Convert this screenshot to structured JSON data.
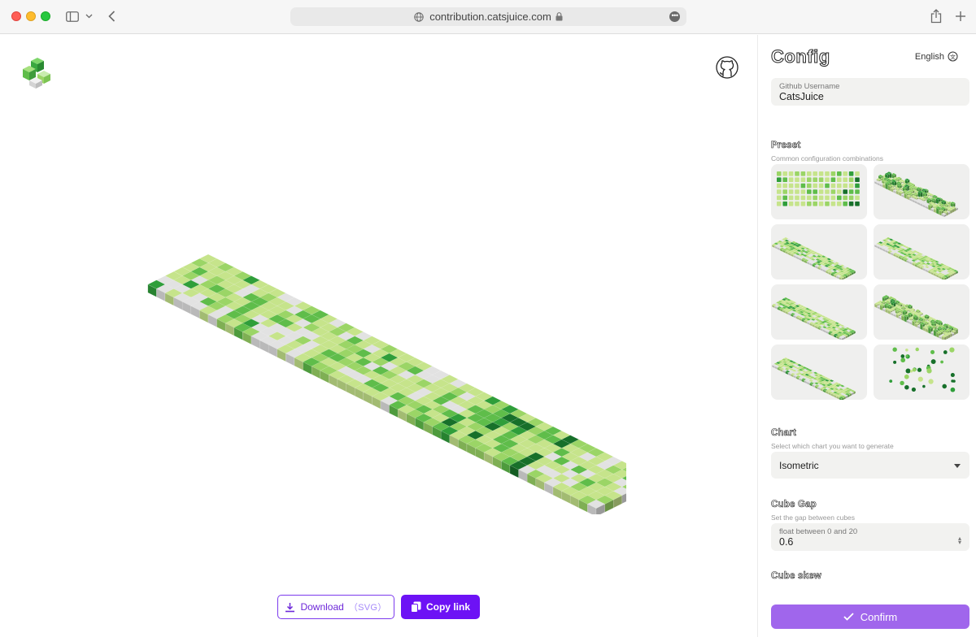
{
  "browser": {
    "url": "contribution.catsjuice.com",
    "icons": [
      "sidebar-icon",
      "chevron-down-icon",
      "back-icon",
      "globe-icon",
      "lock-icon",
      "more-icon",
      "share-icon",
      "plus-icon"
    ]
  },
  "main": {
    "logo": "cube-logo",
    "github_icon": "github-icon",
    "download": {
      "label": "Download",
      "suffix": "（SVG）"
    },
    "copy_link": {
      "label": "Copy link"
    }
  },
  "panel": {
    "title": "Config",
    "language": "English",
    "username": {
      "label": "Github Username",
      "value": "CatsJuice"
    },
    "preset": {
      "title": "Preset",
      "subtitle": "Common configuration combinations"
    },
    "chart": {
      "title": "Chart",
      "subtitle": "Select which chart you want to generate",
      "value": "Isometric"
    },
    "cube_gap": {
      "title": "Cube Gap",
      "subtitle": "Set the gap between cubes",
      "hint": "float between 0 and 20",
      "value": "0.6"
    },
    "cube_skew": {
      "title": "Cube skew"
    },
    "confirm": "Confirm"
  },
  "colors": {
    "accent": "#6d12f5",
    "confirm": "#a066ec",
    "level0": "#e2e2e2",
    "level1": "#c6e48b",
    "level2": "#9bd566",
    "level3": "#5fbd4a",
    "level4": "#2f9e3a",
    "level5": "#17702a"
  }
}
